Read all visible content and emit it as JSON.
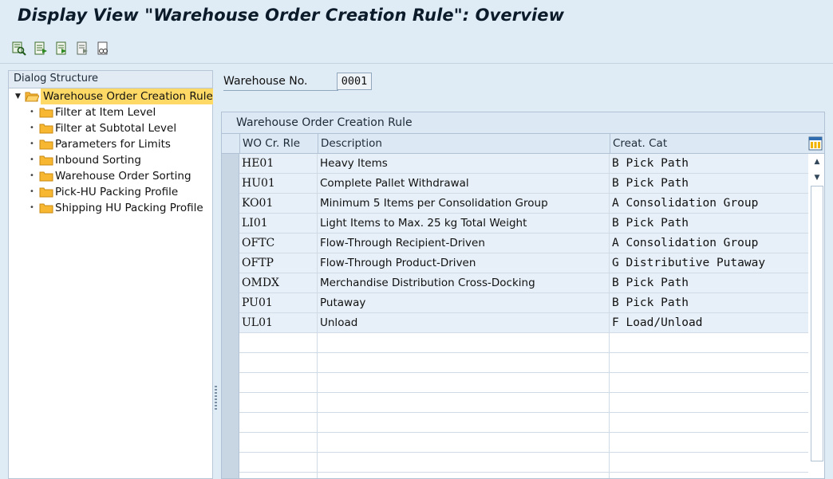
{
  "title": "Display View \"Warehouse Order Creation Rule\": Overview",
  "toolbar": {
    "icons": [
      "find-icon",
      "details-icon",
      "previous-entry-icon",
      "next-entry-icon",
      "print-icon"
    ]
  },
  "dialog_structure": {
    "header": "Dialog Structure",
    "root": "Warehouse Order Creation Rule",
    "children": [
      "Filter at Item Level",
      "Filter at Subtotal Level",
      "Parameters for Limits",
      "Inbound Sorting",
      "Warehouse Order Sorting",
      "Pick-HU Packing Profile",
      "Shipping HU Packing Profile"
    ]
  },
  "warehouse": {
    "label": "Warehouse No.",
    "value": "0001"
  },
  "table": {
    "title": "Warehouse Order Creation Rule",
    "columns": [
      "WO Cr. Rle",
      "Description",
      "Creat. Cat"
    ],
    "rows": [
      [
        "HE01",
        "Heavy Items",
        "B Pick Path"
      ],
      [
        "HU01",
        "Complete Pallet Withdrawal",
        "B Pick Path"
      ],
      [
        "KO01",
        "Minimum 5 Items per Consolidation Group",
        "A Consolidation Group"
      ],
      [
        "LI01",
        "Light Items to Max. 25 kg Total Weight",
        "B Pick Path"
      ],
      [
        "OFTC",
        "Flow-Through Recipient-Driven",
        "A Consolidation Group"
      ],
      [
        "OFTP",
        "Flow-Through Product-Driven",
        "G Distributive Putaway"
      ],
      [
        "OMDX",
        "Merchandise Distribution Cross-Docking",
        "B Pick Path"
      ],
      [
        "PU01",
        "Putaway",
        "B Pick Path"
      ],
      [
        "UL01",
        "Unload",
        "F Load/Unload"
      ]
    ],
    "empty_rows": 8
  }
}
